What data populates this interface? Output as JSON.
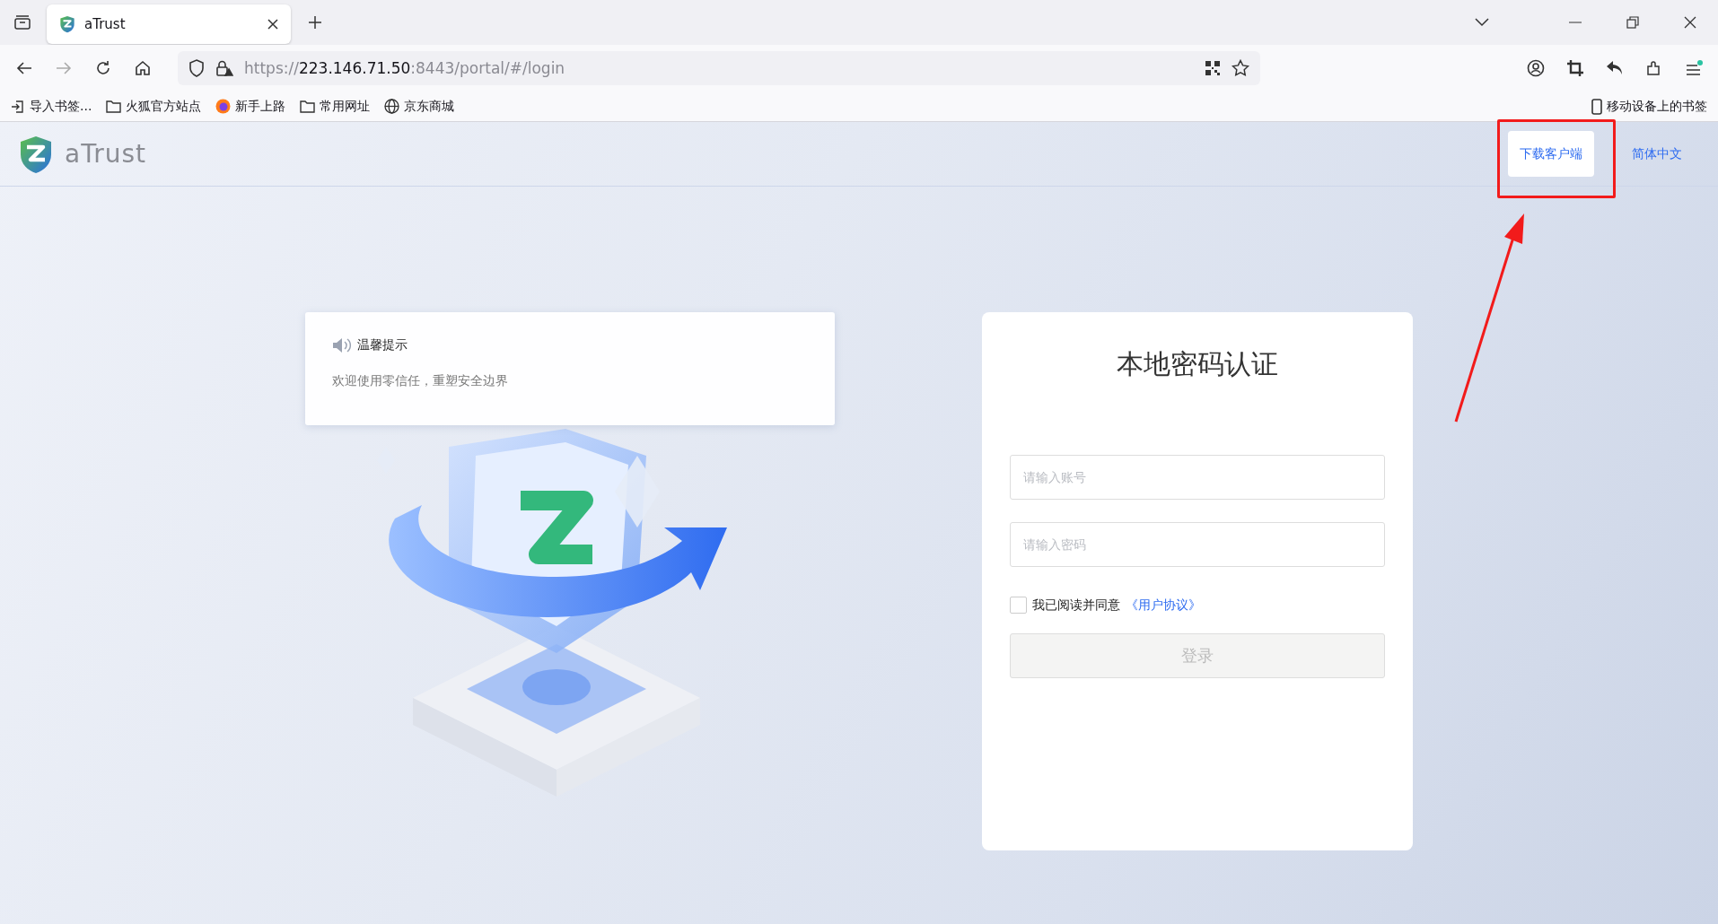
{
  "browser": {
    "tabs": [
      {
        "title": "aTrust",
        "selected": true
      }
    ],
    "url": {
      "scheme": "https://",
      "host": "223.146.71.50",
      "path": ":8443/portal/#/login"
    },
    "bookmarks": [
      {
        "label": "导入书签...",
        "kind": "import"
      },
      {
        "label": "火狐官方站点",
        "kind": "folder"
      },
      {
        "label": "新手上路",
        "kind": "browser"
      },
      {
        "label": "常用网址",
        "kind": "folder"
      },
      {
        "label": "京东商城",
        "kind": "globe"
      }
    ],
    "mobile_bookmarks": "移动设备上的书签"
  },
  "header": {
    "brand": "aTrust",
    "download_button": "下载客户端",
    "language": "简体中文"
  },
  "notice": {
    "title": "温馨提示",
    "message": "欢迎使用零信任，重塑安全边界"
  },
  "login": {
    "title": "本地密码认证",
    "account": {
      "placeholder": "请输入账号"
    },
    "password": {
      "placeholder": "请输入密码"
    },
    "agreement": {
      "checked": false,
      "text": "我已阅读并同意",
      "link": "《用户协议》"
    },
    "submit": {
      "label": "登录",
      "disabled": true
    }
  },
  "annotation": {
    "highlight": true
  }
}
